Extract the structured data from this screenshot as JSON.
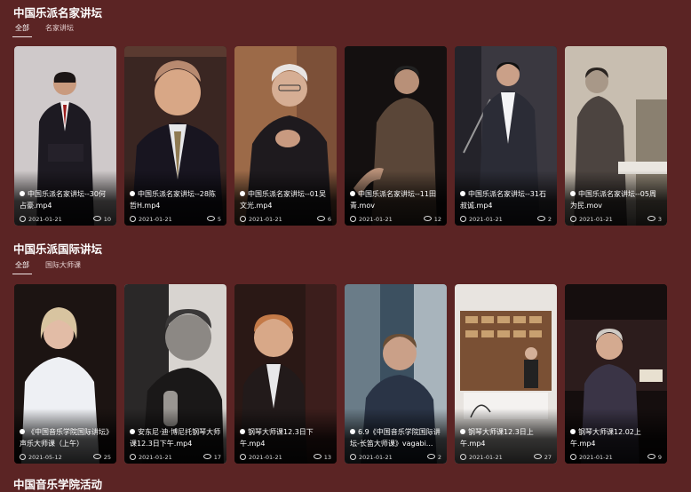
{
  "sections": [
    {
      "title": "中国乐派名家讲坛",
      "tabs": [
        "全部",
        "名家讲坛"
      ],
      "cards": [
        {
          "title": "中国乐派名家讲坛--30何占豪.mp4",
          "date": "2021-01-21",
          "views": "10",
          "bg": "#c9c3c4"
        },
        {
          "title": "中国乐派名家讲坛--28陈哲H.mp4",
          "date": "2021-01-21",
          "views": "5",
          "bg": "#3a2622"
        },
        {
          "title": "中国乐派名家讲坛--01吴文光.mp4",
          "date": "2021-01-21",
          "views": "6",
          "bg": "#9c6a48"
        },
        {
          "title": "中国乐派名家讲坛--11田青.mov",
          "date": "2021-01-21",
          "views": "12",
          "bg": "#161212"
        },
        {
          "title": "中国乐派名家讲坛--31石叔诚.mp4",
          "date": "2021-01-21",
          "views": "2",
          "bg": "#3a3840"
        },
        {
          "title": "中国乐派名家讲坛--05周为民.mov",
          "date": "2021-01-21",
          "views": "3",
          "bg": "#c8beb0"
        }
      ]
    },
    {
      "title": "中国乐派国际讲坛",
      "tabs": [
        "全部",
        "国际大师课"
      ],
      "cards": [
        {
          "title": "《中国音乐学院国际讲坛》声乐大师课（上午）",
          "date": "2021-05-12",
          "views": "25",
          "bg": "#1c1412"
        },
        {
          "title": "安东尼·迪·博尼托钢琴大师课12.3日下午.mp4",
          "date": "2021-01-21",
          "views": "17",
          "bg": "#d8d4d0"
        },
        {
          "title": "钢琴大师课12.3日下午.mp4",
          "date": "2021-01-21",
          "views": "13",
          "bg": "#2a1815"
        },
        {
          "title": "6.9《中国音乐学院国际讲坛-长笛大师课》vagabi...",
          "date": "2021-01-21",
          "views": "2",
          "bg": "#3c5060"
        },
        {
          "title": "钢琴大师课12.3日上午.mp4",
          "date": "2021-01-21",
          "views": "27",
          "bg": "#e8e4e0"
        },
        {
          "title": "钢琴大师课12.02上午.mp4",
          "date": "2021-01-21",
          "views": "9",
          "bg": "#150e0e"
        }
      ]
    },
    {
      "title": "中国音乐学院活动"
    }
  ],
  "icons": {
    "play": "play-icon",
    "clock": "clock-icon",
    "views": "eye-icon"
  }
}
